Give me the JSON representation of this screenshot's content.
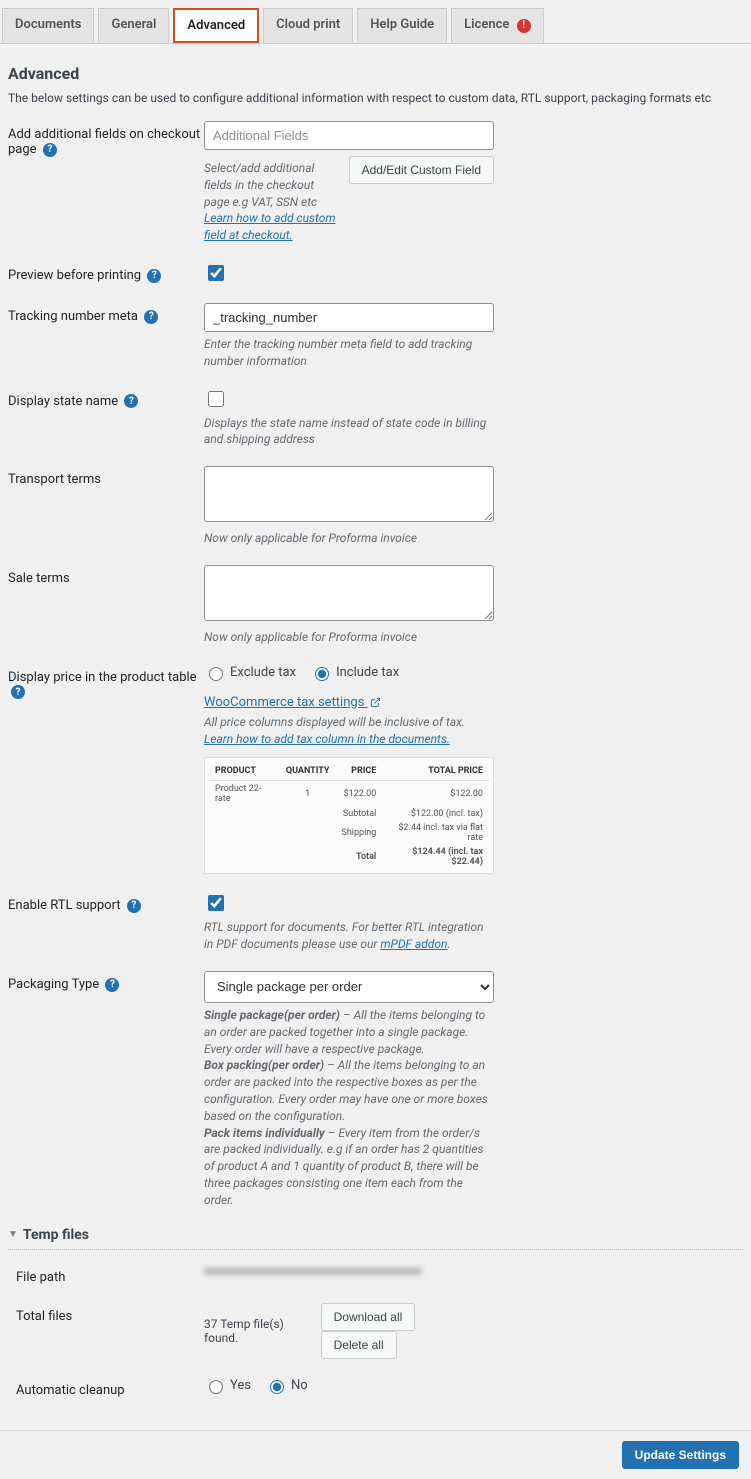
{
  "tabs": {
    "documents": "Documents",
    "general": "General",
    "advanced": "Advanced",
    "cloud_print": "Cloud print",
    "help_guide": "Help Guide",
    "licence": "Licence"
  },
  "page": {
    "title": "Advanced",
    "intro": "The below settings can be used to configure additional information with respect to custom data, RTL support, packaging formats etc"
  },
  "add_fields": {
    "label": "Add additional fields on checkout page",
    "placeholder": "Additional Fields",
    "desc1": "Select/add additional fields in the checkout page e.g VAT, SSN etc",
    "link": "Learn how to add custom field at checkout.",
    "button": "Add/Edit Custom Field"
  },
  "preview": {
    "label": "Preview before printing"
  },
  "tracking": {
    "label": "Tracking number meta",
    "value": "_tracking_number",
    "desc": "Enter the tracking number meta field to add tracking number information"
  },
  "state": {
    "label": "Display state name",
    "desc": "Displays the state name instead of state code in billing and shipping address"
  },
  "transport": {
    "label": "Transport terms",
    "desc": "Now only applicable for Proforma invoice"
  },
  "sale": {
    "label": "Sale terms",
    "desc": "Now only applicable for Proforma invoice"
  },
  "price": {
    "label": "Display price in the product table",
    "exclude": "Exclude tax",
    "include": "Include tax",
    "settings_link": "WooCommerce tax settings",
    "desc1": "All price columns displayed will be inclusive of tax.",
    "desc_link": "Learn how to add tax column in the documents."
  },
  "chart_data": {
    "type": "table",
    "title": "",
    "columns": [
      "PRODUCT",
      "QUANTITY",
      "PRICE",
      "TOTAL PRICE"
    ],
    "rows": [
      {
        "product": "Product 22-rate",
        "quantity": 1,
        "price": "$122.00",
        "total": "$122.00"
      }
    ],
    "totals": [
      {
        "label": "Subtotal",
        "value": "$122.00 (incl. tax)"
      },
      {
        "label": "Shipping",
        "value": "$2.44 incl. tax via flat rate"
      },
      {
        "label": "Total",
        "value": "$124.44 (incl. tax $22.44)",
        "bold": true
      }
    ]
  },
  "rtl": {
    "label": "Enable RTL support",
    "desc1": "RTL support for documents. For better RTL integration in PDF documents please use our",
    "link": "mPDF addon",
    "desc2": "."
  },
  "packaging": {
    "label": "Packaging Type",
    "selected": "Single package per order",
    "desc_single_bold": "Single package(per order)",
    "desc_single": " – All the items belonging to an order are packed together into a single package. Every order will have a respective package.",
    "desc_box_bold": "Box packing(per order)",
    "desc_box": " – All the items belonging to an order are packed into the respective boxes as per the configuration. Every order may have one or more boxes based on the configuration.",
    "desc_pack_bold": "Pack items individually",
    "desc_pack": " – Every item from the order/s are packed individually. e.g if an order has 2 quantities of product A and 1 quantity of product B, there will be three packages consisting one item each from the order."
  },
  "temp": {
    "section_title": "Temp files",
    "filepath_label": "File path",
    "filepath_value": "■■■■■■■■■■■■■■■■■■■■■■■■■■■■■■",
    "total_label": "Total files",
    "total_value": "37 Temp file(s) found.",
    "download_btn": "Download all",
    "delete_btn": "Delete all",
    "cleanup_label": "Automatic cleanup",
    "yes": "Yes",
    "no": "No"
  },
  "footer": {
    "update": "Update Settings"
  }
}
